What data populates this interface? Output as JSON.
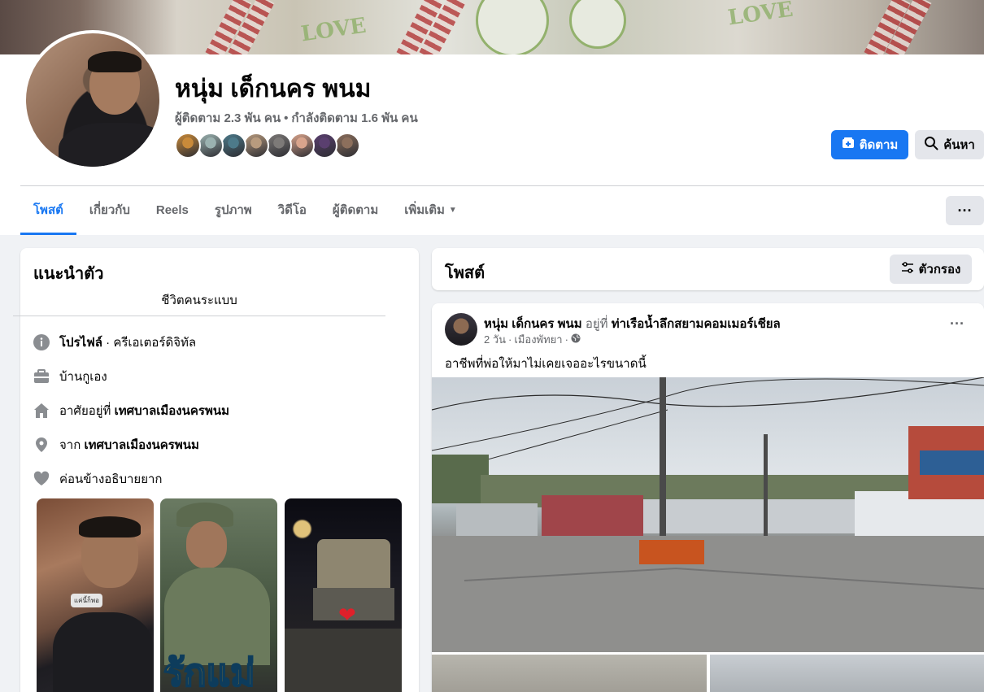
{
  "profile": {
    "name": "หนุ่ม เด็กนคร พนม",
    "followers": "ผู้ติดตาม 2.3 พัน คน",
    "following": "กำลังติดตาม 1.6 พัน คน",
    "separator": "•",
    "follow_button": "ติดตาม",
    "search_button": "ค้นหา",
    "friend_avatar_colors": [
      "#c98a3a",
      "#9bb2b0",
      "#4d7a8a",
      "#b89b7e",
      "#7d7a78",
      "#d9a48c",
      "#5a3f6f",
      "#8c6f5c"
    ]
  },
  "tabs": [
    {
      "label": "โพสต์",
      "active": true
    },
    {
      "label": "เกี่ยวกับ",
      "active": false
    },
    {
      "label": "Reels",
      "active": false
    },
    {
      "label": "รูปภาพ",
      "active": false
    },
    {
      "label": "วิดีโอ",
      "active": false
    },
    {
      "label": "ผู้ติดตาม",
      "active": false
    },
    {
      "label": "เพิ่มเติม",
      "active": false
    }
  ],
  "intro": {
    "title": "แนะนำตัว",
    "bio": "ชีวิตคนระแบบ",
    "items": [
      {
        "icon": "info-icon",
        "label_bold": "โปรไฟล์",
        "label": " · ครีเอเตอร์ดิจิทัล"
      },
      {
        "icon": "briefcase-icon",
        "label": "บ้านกูเอง",
        "label_bold": ""
      },
      {
        "icon": "home-icon",
        "label": "อาศัยอยู่ที่ ",
        "label_bold": "เทศบาลเมืองนครพนม"
      },
      {
        "icon": "location-icon",
        "label": "จาก ",
        "label_bold": "เทศบาลเมืองนครพนม"
      },
      {
        "icon": "heart-icon",
        "label": "ค่อนข้างอธิบายยาก",
        "label_bold": ""
      }
    ],
    "photo_overlay_text": "รักแม่",
    "photo_tag_text": "แค่นี้ก็พอ"
  },
  "posts": {
    "title": "โพสต์",
    "filter_button": "ตัวกรอง",
    "post": {
      "author": "หนุ่ม เด็กนคร พนม",
      "at_text": "อยู่ที่",
      "place": "ท่าเรือน้ำลึกสยามคอมเมอร์เชียล",
      "time": "2 วัน",
      "location": "เมืองพัทยา",
      "dot": "·",
      "text": "อาชีพที่พ่อให้มาไม่เคยเจออะไรขนาดนี้"
    }
  },
  "colors": {
    "accent": "#1877f2",
    "secondary_text": "#65676b",
    "button_gray": "#e4e6eb"
  }
}
